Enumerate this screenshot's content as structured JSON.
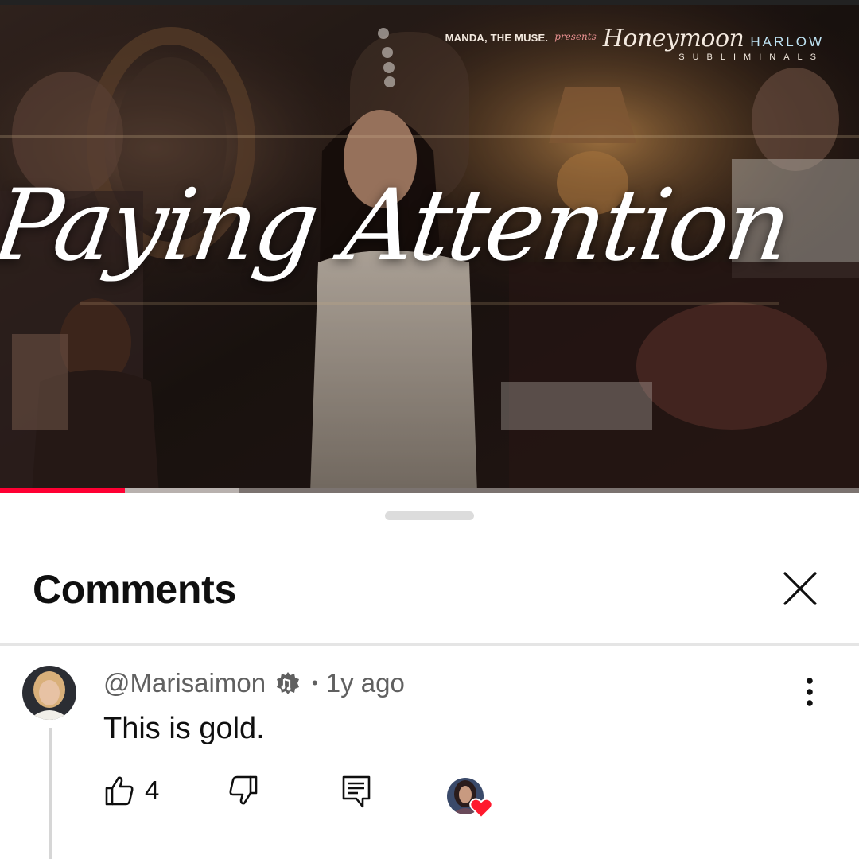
{
  "video": {
    "title_overlay": "Paying Attention",
    "brand": {
      "presenter": "MANDA, THE MUSE.",
      "presents": "presents",
      "script": "Honeymoon",
      "word": "HARLOW",
      "sub": "SUBLIMINALS"
    },
    "progress": {
      "played_percent": 14.5,
      "buffered_percent": 27.8
    }
  },
  "sheet": {
    "title": "Comments",
    "close_icon": "close-icon"
  },
  "comments": [
    {
      "author": "@Marisaimon",
      "age": "1y ago",
      "text": "This is gold.",
      "likes": "4",
      "verified_icon": "creator-badge-icon",
      "creator_hearted": true
    }
  ],
  "colors": {
    "progress_red": "#ff0033",
    "heart_red": "#ff1a2e",
    "meta_gray": "#606060",
    "divider": "#e5e5e5"
  }
}
